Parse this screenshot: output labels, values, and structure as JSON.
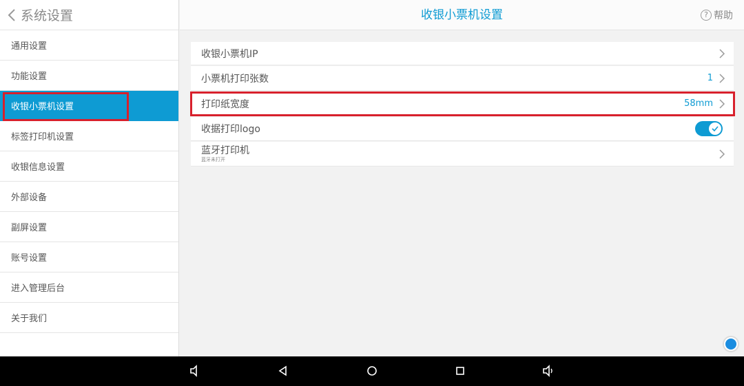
{
  "sidebar": {
    "back_label": "系统设置",
    "items": [
      {
        "label": "通用设置"
      },
      {
        "label": "功能设置"
      },
      {
        "label": "收银小票机设置"
      },
      {
        "label": "标签打印机设置"
      },
      {
        "label": "收银信息设置"
      },
      {
        "label": "外部设备"
      },
      {
        "label": "副屏设置"
      },
      {
        "label": "账号设置"
      },
      {
        "label": "进入管理后台"
      },
      {
        "label": "关于我们"
      }
    ],
    "active_index": 2
  },
  "header": {
    "title": "收银小票机设置",
    "help_label": "帮助",
    "help_icon": "?"
  },
  "settings": {
    "printer_ip": {
      "label": "收银小票机IP"
    },
    "print_copies": {
      "label": "小票机打印张数",
      "value": "1"
    },
    "paper_width": {
      "label": "打印纸宽度",
      "value": "58mm"
    },
    "print_logo": {
      "label": "收据打印logo",
      "enabled": true
    },
    "bluetooth": {
      "label": "蓝牙打印机",
      "status": "蓝牙未打开"
    }
  },
  "colors": {
    "accent": "#0e9bd3",
    "highlight_box": "#d8202c"
  },
  "icons": [
    "back-chevron-icon",
    "help-icon",
    "chevron-right-icon",
    "check-icon",
    "floating-assist-icon",
    "volume-down-icon",
    "back-triangle-icon",
    "home-circle-icon",
    "recents-square-icon",
    "volume-up-icon"
  ]
}
